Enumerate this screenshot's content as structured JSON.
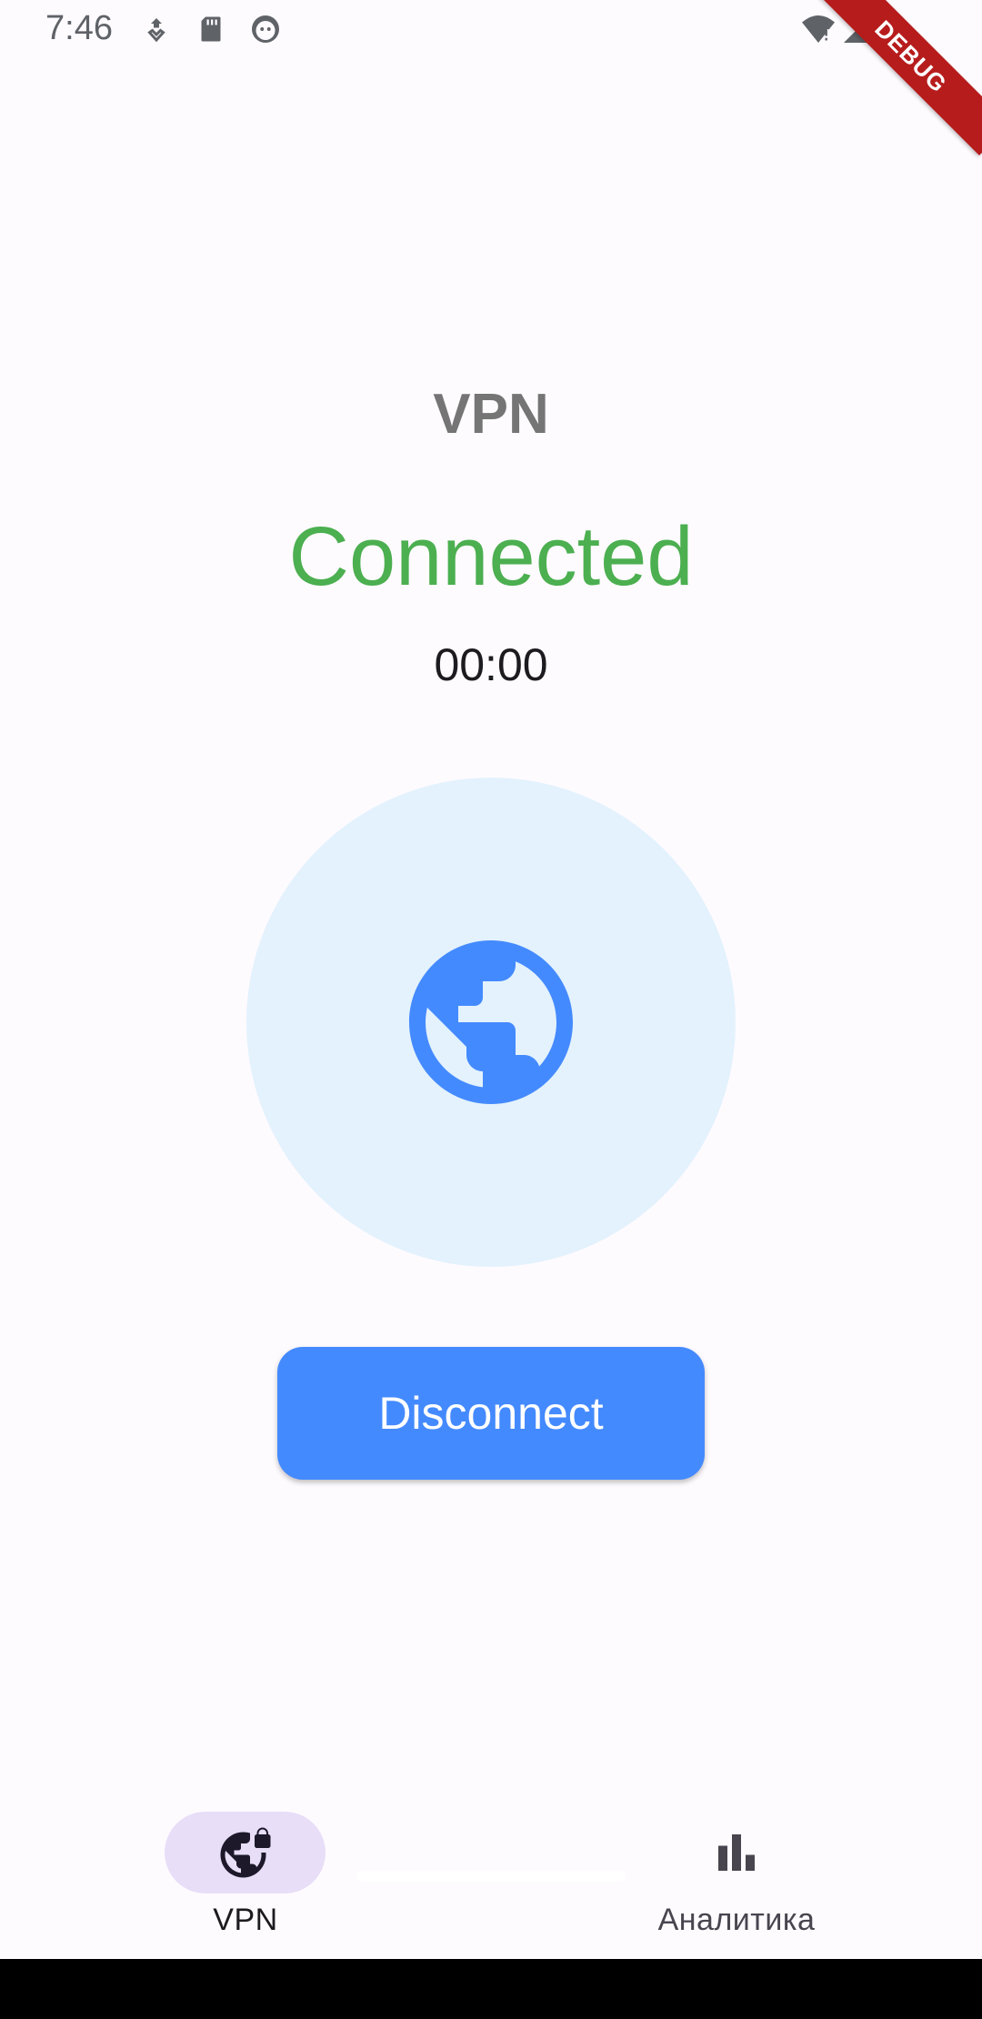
{
  "status_bar": {
    "time": "7:46",
    "icons": [
      "download-icon",
      "sd-card-icon",
      "face-icon",
      "wifi-icon",
      "signal-icon"
    ]
  },
  "debug_banner": "DEBUG",
  "main": {
    "title": "VPN",
    "connection_status": "Connected",
    "timer": "00:00",
    "globe_icon": "globe-icon",
    "disconnect_label": "Disconnect"
  },
  "bottom_nav": {
    "items": [
      {
        "label": "VPN",
        "icon": "vpn-lock-icon",
        "selected": true
      },
      {
        "label": "Аналитика",
        "icon": "bar-chart-icon",
        "selected": false
      }
    ]
  },
  "colors": {
    "connected": "#4caf50",
    "accent": "#448aff",
    "circle_bg": "#e3f2fd",
    "nav_pill": "#e8def8",
    "debug": "#b71c1c"
  }
}
